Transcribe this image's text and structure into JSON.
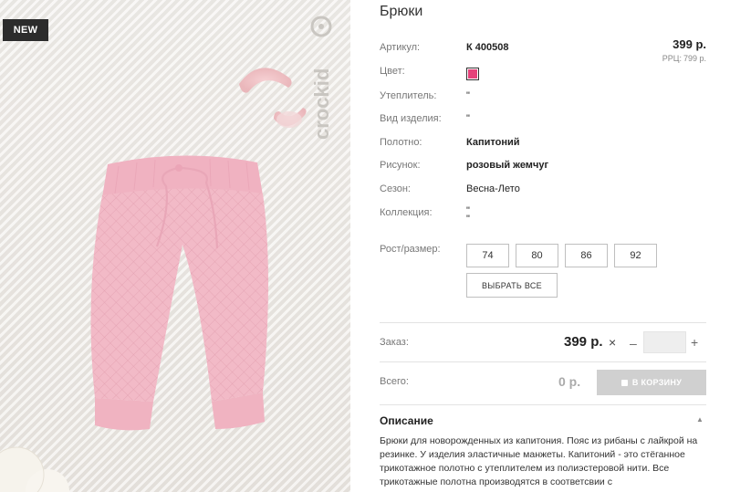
{
  "badge": {
    "label": "NEW"
  },
  "brand": {
    "name": "crockid"
  },
  "product": {
    "title": "Брюки",
    "price": "399 р.",
    "rrc_label": "РРЦ:",
    "rrc_value": "799 р.",
    "color_hex": "#e5427a",
    "attributes": [
      {
        "label": "Артикул:",
        "value": "К 400508"
      },
      {
        "label": "Цвет:",
        "value": ""
      },
      {
        "label": "Утеплитель:",
        "value": "\""
      },
      {
        "label": "Вид изделия:",
        "value": "\""
      },
      {
        "label": "Полотно:",
        "value": "Капитоний"
      },
      {
        "label": "Рисунок:",
        "value": "розовый жемчуг"
      },
      {
        "label": "Сезон:",
        "value": "Весна-Лето"
      },
      {
        "label": "Коллекция:",
        "value": "\"\n\""
      }
    ],
    "size_label": "Рост/размер:",
    "sizes": [
      "74",
      "80",
      "86",
      "92"
    ],
    "select_all_label": "ВЫБРАТЬ ВСЕ"
  },
  "order": {
    "label": "Заказ:",
    "unit_price": "399 р.",
    "times_symbol": "×",
    "minus_symbol": "–",
    "plus_symbol": "+",
    "quantity": ""
  },
  "total": {
    "label": "Всего:",
    "value": "0 р.",
    "cart_button_label": "В КОРЗИНУ"
  },
  "description": {
    "heading": "Описание",
    "text": "Брюки для новорожденных из капитония. Пояс из рибаны с лайкрой на резинке. У изделия эластичные манжеты. Капитоний - это стёганное трикотажное полотно с утеплителем из полиэстеровой нити. Все трикотажные полотна производятся в соответсвии с"
  },
  "colors": {
    "accent_pink": "#e5427a",
    "pants_pink": "#f2b9c6",
    "badge_bg": "#2c2c2c",
    "disabled_button": "#d0d0d0"
  }
}
